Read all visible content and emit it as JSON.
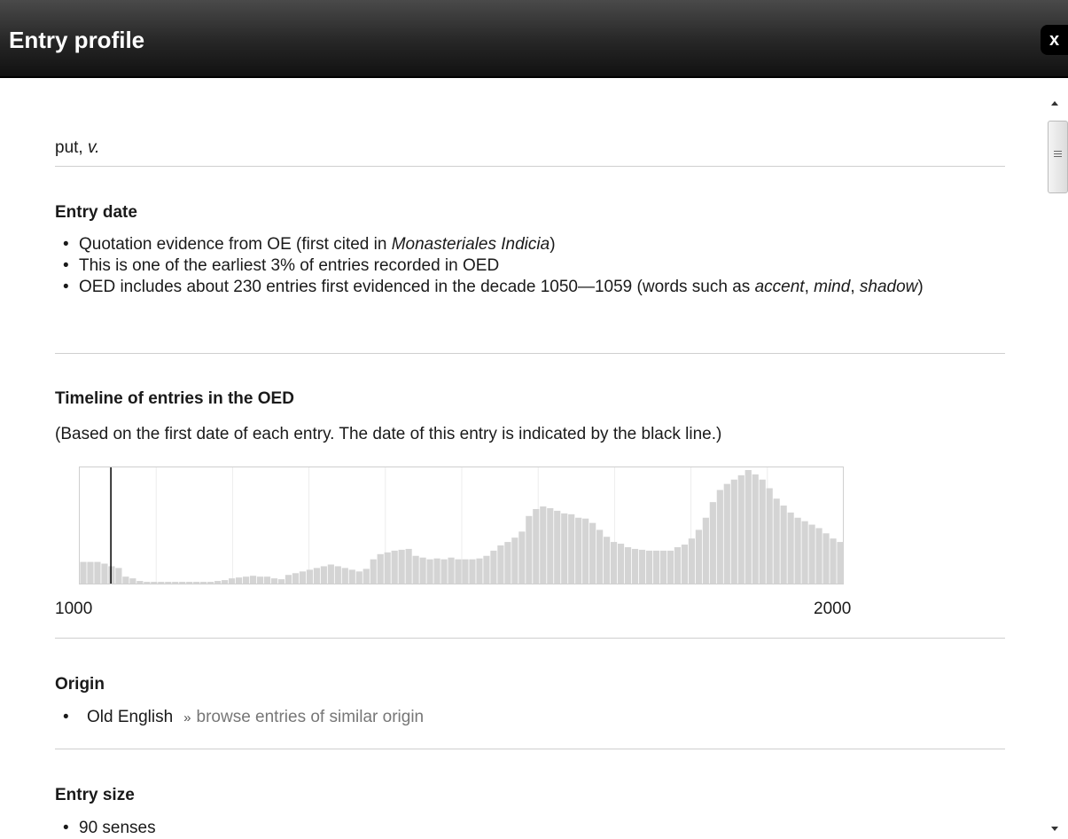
{
  "dialog": {
    "title": "Entry profile",
    "close_label": "x"
  },
  "entry": {
    "headword": "put,",
    "pos": "v."
  },
  "entry_date": {
    "heading": "Entry date",
    "bullets": [
      {
        "text": "Quotation evidence from OE (first cited in ",
        "italic": "Monasteriales Indicia",
        "end": ")"
      },
      {
        "text": "This is one of the earliest 3% of entries recorded in OED"
      },
      {
        "text": "OED includes about 230 entries first evidenced in the decade 1050—1059 (words such as ",
        "italic1": "accent",
        "line2_sep": ",",
        "italic2": "mind",
        "sep2": ", ",
        "italic3": "shadow",
        "end": ")"
      }
    ]
  },
  "timeline": {
    "heading": "Timeline of entries in the OED",
    "note": "(Based on the first date of each entry. The date of this entry is indicated by the black line.)",
    "axis_start": "1000",
    "axis_end": "2000"
  },
  "chart_data": {
    "type": "bar",
    "x_range": [
      1000,
      2000
    ],
    "bin_width_years": 10,
    "marker_year": 1050,
    "values": [
      25,
      25,
      25,
      23,
      20,
      18,
      8,
      6,
      3,
      2,
      2,
      2,
      2,
      2,
      2,
      2,
      2,
      2,
      2,
      3,
      4,
      6,
      7,
      8,
      9,
      8,
      8,
      6,
      5,
      10,
      12,
      14,
      16,
      18,
      20,
      22,
      20,
      18,
      16,
      14,
      17,
      28,
      34,
      36,
      38,
      39,
      40,
      32,
      30,
      28,
      29,
      28,
      30,
      28,
      28,
      28,
      29,
      32,
      38,
      44,
      48,
      53,
      60,
      78,
      86,
      89,
      87,
      84,
      81,
      80,
      76,
      75,
      70,
      62,
      54,
      48,
      46,
      42,
      40,
      39,
      38,
      38,
      38,
      38,
      42,
      45,
      52,
      62,
      76,
      94,
      108,
      115,
      120,
      125,
      131,
      126,
      120,
      110,
      98,
      90,
      82,
      76,
      72,
      68,
      64,
      58,
      52,
      48
    ],
    "values_scale_note": "relative bar heights",
    "grid": true,
    "legend": "none"
  },
  "origin": {
    "heading": "Origin",
    "item": "Old English",
    "raquo": "»",
    "link": "browse entries of similar origin"
  },
  "entry_size": {
    "heading": "Entry size",
    "item": "90 senses"
  },
  "icons": {
    "close": "close-icon",
    "scroll_up": "chevron-up-icon",
    "scroll_down": "chevron-down-icon"
  }
}
